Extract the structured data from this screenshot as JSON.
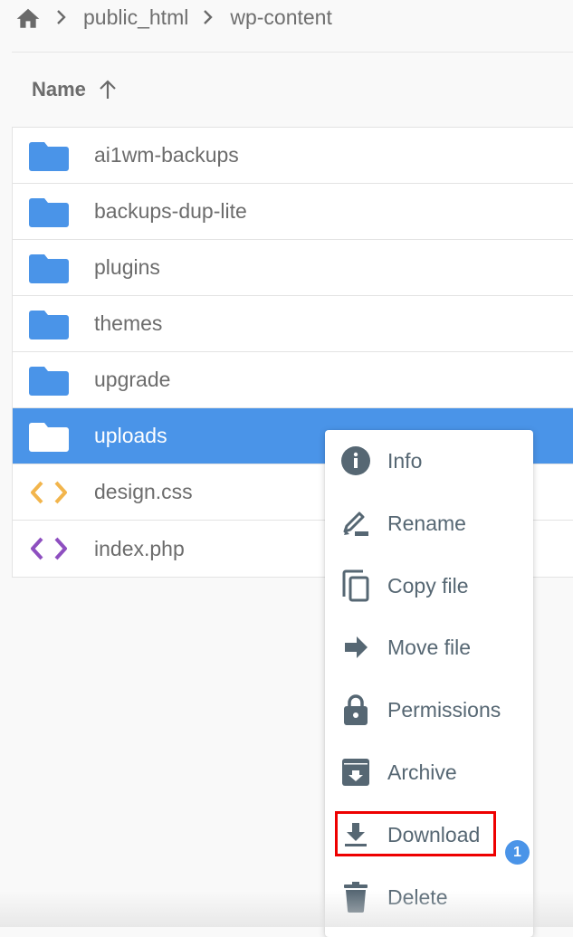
{
  "breadcrumb": {
    "home_icon": "home-icon",
    "items": [
      "public_html",
      "wp-content"
    ]
  },
  "table": {
    "column_header": "Name",
    "sort_icon": "arrow-up-icon",
    "rows": [
      {
        "name": "ai1wm-backups",
        "type": "folder",
        "icon": "folder-icon"
      },
      {
        "name": "backups-dup-lite",
        "type": "folder",
        "icon": "folder-icon"
      },
      {
        "name": "plugins",
        "type": "folder",
        "icon": "folder-icon"
      },
      {
        "name": "themes",
        "type": "folder",
        "icon": "folder-icon"
      },
      {
        "name": "upgrade",
        "type": "folder",
        "icon": "folder-icon"
      },
      {
        "name": "uploads",
        "type": "folder",
        "icon": "folder-icon",
        "selected": true
      },
      {
        "name": "design.css",
        "type": "code",
        "icon": "code-icon",
        "color": "#f2b54c"
      },
      {
        "name": "index.php",
        "type": "code",
        "icon": "code-icon",
        "color": "#8e4fc0"
      }
    ]
  },
  "context_menu": {
    "items": [
      {
        "label": "Info",
        "icon": "info-icon"
      },
      {
        "label": "Rename",
        "icon": "pencil-icon"
      },
      {
        "label": "Copy file",
        "icon": "copy-icon"
      },
      {
        "label": "Move file",
        "icon": "arrow-right-icon"
      },
      {
        "label": "Permissions",
        "icon": "lock-icon"
      },
      {
        "label": "Archive",
        "icon": "archive-icon"
      },
      {
        "label": "Download",
        "icon": "download-icon",
        "highlighted": true
      },
      {
        "label": "Delete",
        "icon": "trash-icon"
      }
    ]
  },
  "annotation": {
    "step_badge": "1",
    "highlight_color": "#ee0000"
  },
  "colors": {
    "accent": "#4a94e8",
    "folder": "#4a94e8",
    "menu_icon": "#566773"
  }
}
